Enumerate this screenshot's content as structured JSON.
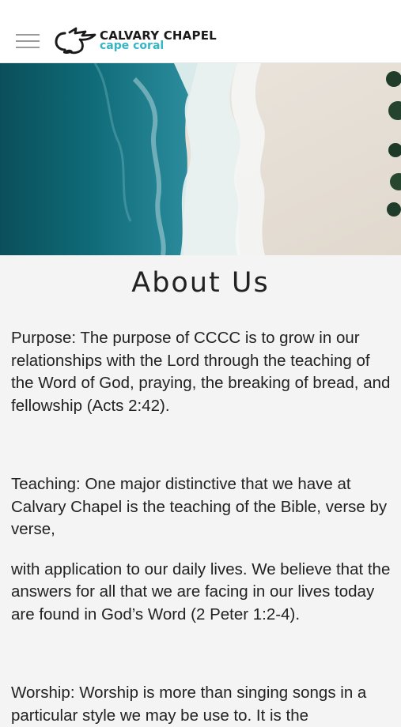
{
  "header": {
    "logo": {
      "name": "CALVARY CHAPEL",
      "sub": "cape coral"
    }
  },
  "page": {
    "title": "About Us",
    "paragraphs": [
      "Purpose: The purpose of CCCC is to grow in our relationships with the Lord through the teaching of the Word of God, praying, the breaking of bread, and fellowship (Acts 2:42).",
      "Teaching: One major distinctive that we have at Calvary Chapel is the teaching of the Bible, verse by verse,",
      "with application to our daily lives. We believe that the answers for all that we are facing in our lives today are found in God’s Word (2 Peter 1:2-4).",
      "Worship: Worship is more than singing songs in a particular style we may be use to. It is the"
    ]
  },
  "colors": {
    "accent": "#35b6c4",
    "ocean": "#0f5f6c",
    "sand": "#e9e3db"
  },
  "icons": {
    "menu": "hamburger-menu-icon",
    "logo": "dove-logo-icon"
  }
}
